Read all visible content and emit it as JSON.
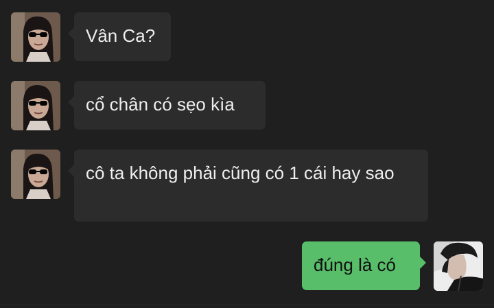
{
  "messages": [
    {
      "sender": "other",
      "avatar": "girl-sunglasses-avatar",
      "text": "Vân Ca?"
    },
    {
      "sender": "other",
      "avatar": "girl-sunglasses-avatar",
      "text": "cổ chân có sẹo kìa"
    },
    {
      "sender": "other",
      "avatar": "girl-sunglasses-avatar",
      "text": "cô ta không phải cũng có 1 cái hay sao"
    },
    {
      "sender": "self",
      "avatar": "man-profile-avatar",
      "text": "đúng là có"
    }
  ],
  "colors": {
    "background": "#1f1f1f",
    "incoming_bubble": "#2c2c2c",
    "outgoing_bubble": "#58be6a",
    "incoming_text": "#eeeeee",
    "outgoing_text": "#101010"
  }
}
